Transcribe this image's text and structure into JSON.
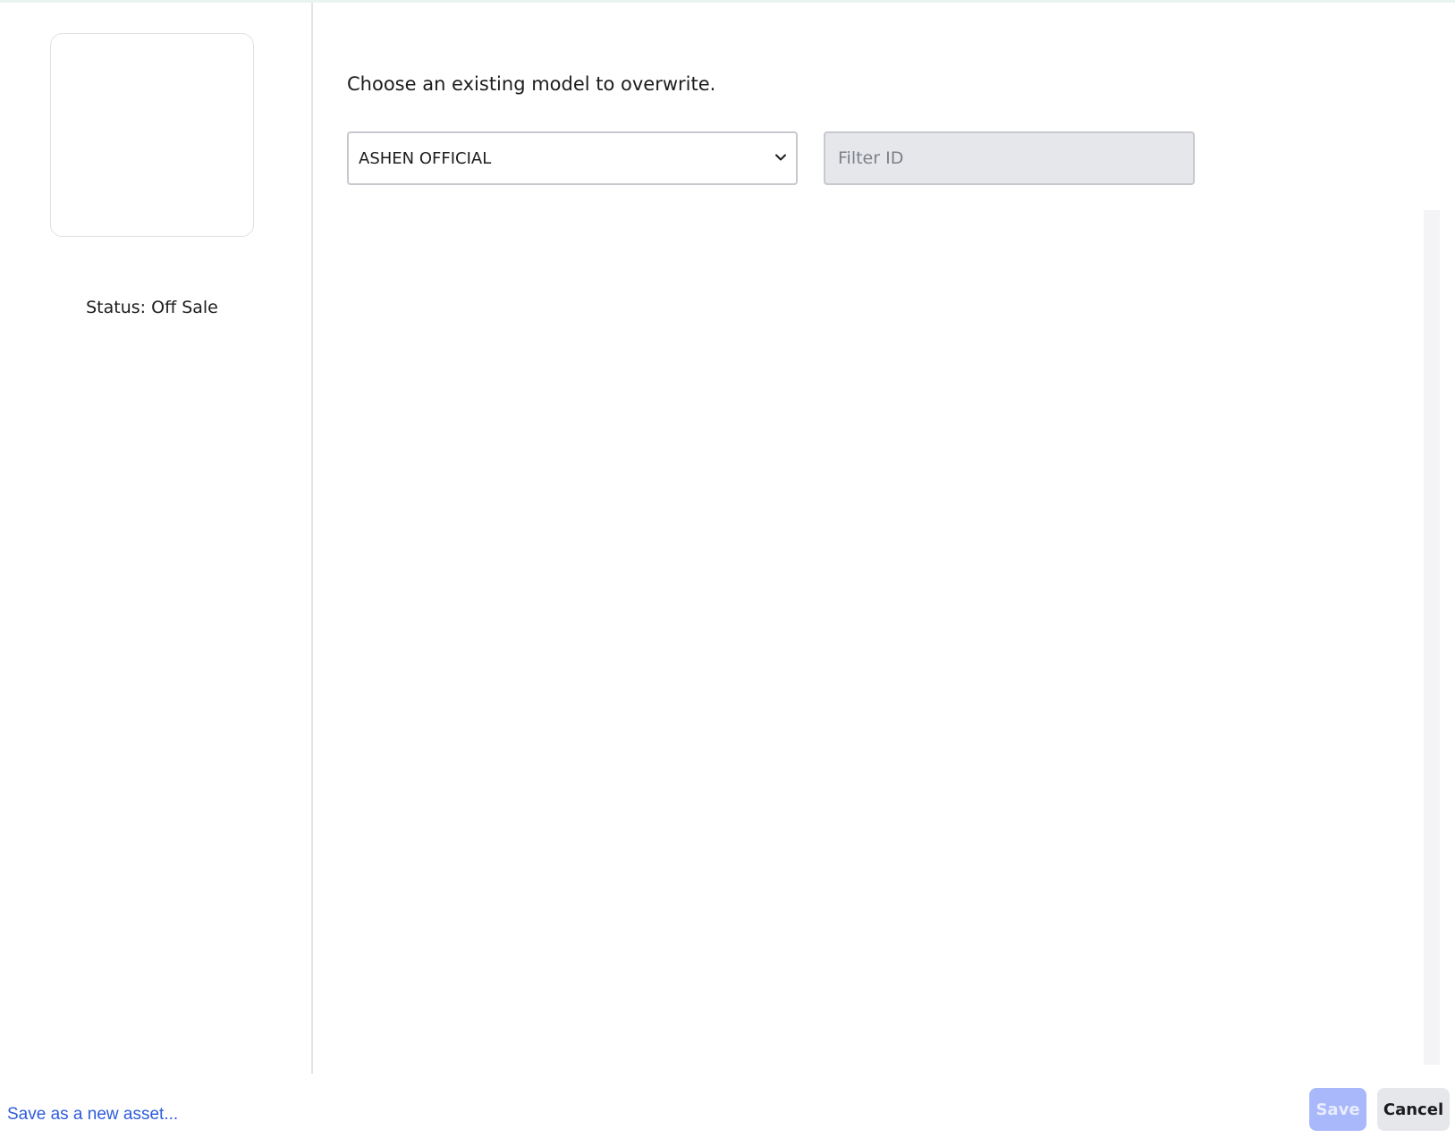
{
  "sidebar": {
    "status_text": "Status: Off Sale"
  },
  "main": {
    "prompt": "Choose an existing model to overwrite.",
    "group_select": {
      "value": "ASHEN OFFICIAL",
      "chevron_icon": "chevron-down-icon"
    },
    "filter": {
      "placeholder": "Filter ID",
      "value": ""
    }
  },
  "footer": {
    "save_as_new_label": "Save as a new asset...",
    "save_label": "Save",
    "cancel_label": "Cancel"
  },
  "colors": {
    "accent_link": "#2d5bdb",
    "save_disabled_bg": "#a9b8fb",
    "cancel_bg": "#e6e7eb",
    "divider": "#e3e4e8"
  }
}
